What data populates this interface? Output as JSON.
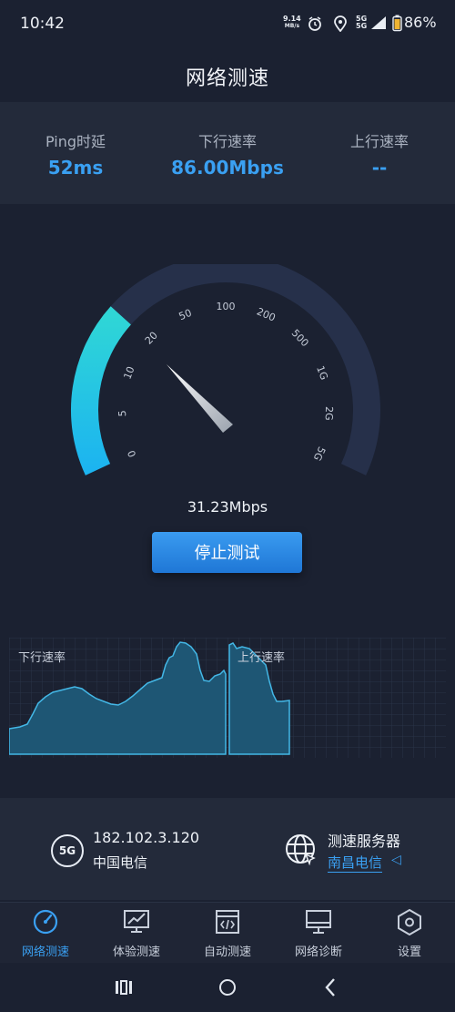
{
  "status_bar": {
    "time": "10:42",
    "net_speed": "9.14",
    "net_unit": "MB/s",
    "signal": "5G",
    "battery": "86%"
  },
  "header": {
    "title": "网络测速"
  },
  "stats": [
    {
      "label": "Ping时延",
      "value": "52ms"
    },
    {
      "label": "下行速率",
      "value": "86.00Mbps"
    },
    {
      "label": "上行速率",
      "value": "--"
    }
  ],
  "gauge": {
    "ticks": [
      "0",
      "5",
      "10",
      "20",
      "50",
      "100",
      "200",
      "500",
      "1G",
      "2G",
      "5G"
    ],
    "current_speed": "31.23Mbps",
    "accent_start": "#2fd6d6",
    "accent_end": "#1cb4f0"
  },
  "action": {
    "stop_label": "停止测试"
  },
  "chart": {
    "download_label": "下行速率",
    "upload_label": "上行速率"
  },
  "info": {
    "badge": "5G",
    "ip": "182.102.3.120",
    "isp": "中国电信",
    "server_title": "测速服务器",
    "server_name": "南昌电信"
  },
  "nav": [
    {
      "label": "网络测速",
      "icon": "speedometer-icon",
      "active": true
    },
    {
      "label": "体验测速",
      "icon": "chart-monitor-icon",
      "active": false
    },
    {
      "label": "自动测速",
      "icon": "code-window-icon",
      "active": false
    },
    {
      "label": "网络诊断",
      "icon": "monitor-icon",
      "active": false
    },
    {
      "label": "设置",
      "icon": "settings-hexagon-icon",
      "active": false
    }
  ],
  "colors": {
    "accent": "#3aa0f2",
    "background": "#1b2131",
    "panel": "#232a3a"
  }
}
